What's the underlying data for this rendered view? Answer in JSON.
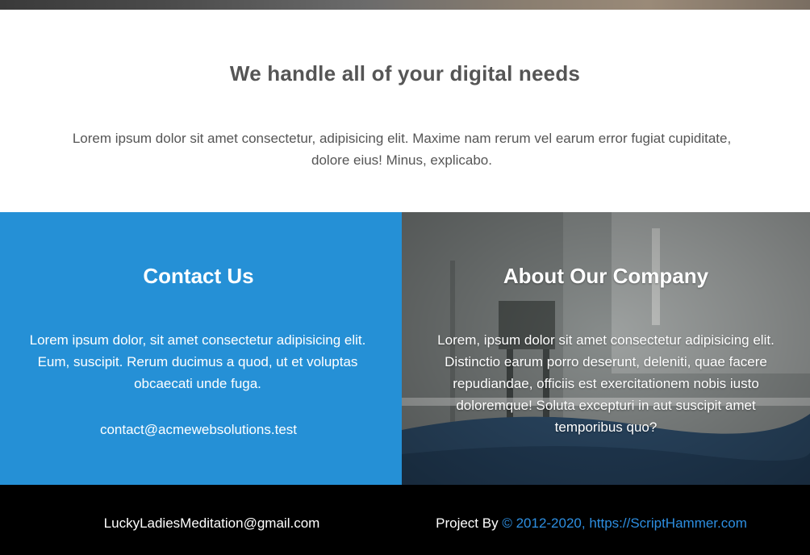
{
  "intro": {
    "title": "We handle all of your digital needs",
    "text": "Lorem ipsum dolor sit amet consectetur, adipisicing elit. Maxime nam rerum vel earum error fugiat cupiditate, dolore eius! Minus, explicabo."
  },
  "contact": {
    "title": "Contact Us",
    "text": "Lorem ipsum dolor, sit amet consectetur adipisicing elit. Eum, suscipit. Rerum ducimus a quod, ut et voluptas obcaecati unde fuga.",
    "email": "contact@acmewebsolutions.test",
    "background": "#2590d6"
  },
  "about": {
    "title": "About Our Company",
    "text": "Lorem, ipsum dolor sit amet consectetur adipisicing elit. Distinctio earum porro deserunt, deleniti, quae facere repudiandae, officiis est exercitationem nobis iusto doloremque! Soluta excepturi in aut suscipit amet temporibus quo?"
  },
  "footer": {
    "email": "LuckyLadiesMeditation@gmail.com",
    "project_by_label": "Project By",
    "credit": "© 2012-2020, https://ScriptHammer.com",
    "link_color": "#2d8ee0",
    "background": "#000000"
  }
}
